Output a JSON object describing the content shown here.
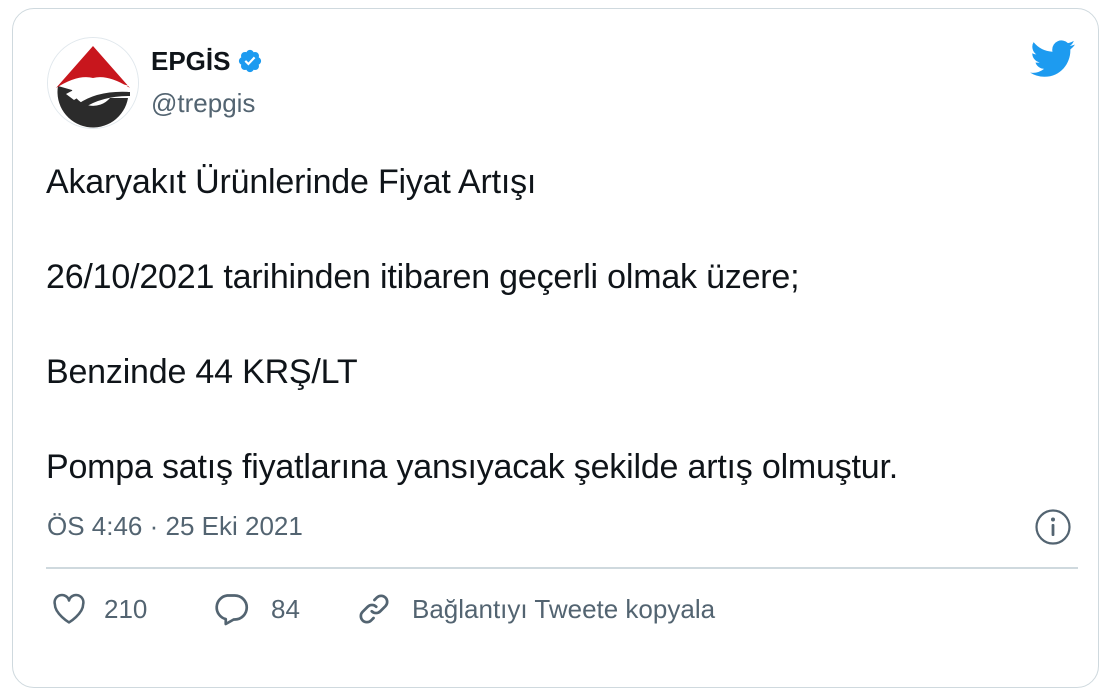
{
  "tweet": {
    "author": {
      "display_name": "EPGİS",
      "handle": "@trepgis",
      "verified": true,
      "avatar_icon": "epgis-logo",
      "avatar_colors": {
        "red": "#c8161d",
        "dark": "#2b2b2b",
        "white": "#ffffff"
      }
    },
    "platform_icon": "twitter-bird-icon",
    "accent_color": "#1d9bf0",
    "lines": [
      "Akaryakıt Ürünlerinde Fiyat Artışı",
      "26/10/2021 tarihinden itibaren geçerli olmak üzere;",
      "Benzinde 44 KRŞ/LT",
      "Pompa satış fiyatlarına yansıyacak şekilde artış olmuştur."
    ],
    "timestamp": "ÖS 4:46 · 25 Eki 2021",
    "actions": {
      "likes": "210",
      "replies": "84",
      "copy_link_label": "Bağlantıyı Tweete kopyala"
    }
  }
}
